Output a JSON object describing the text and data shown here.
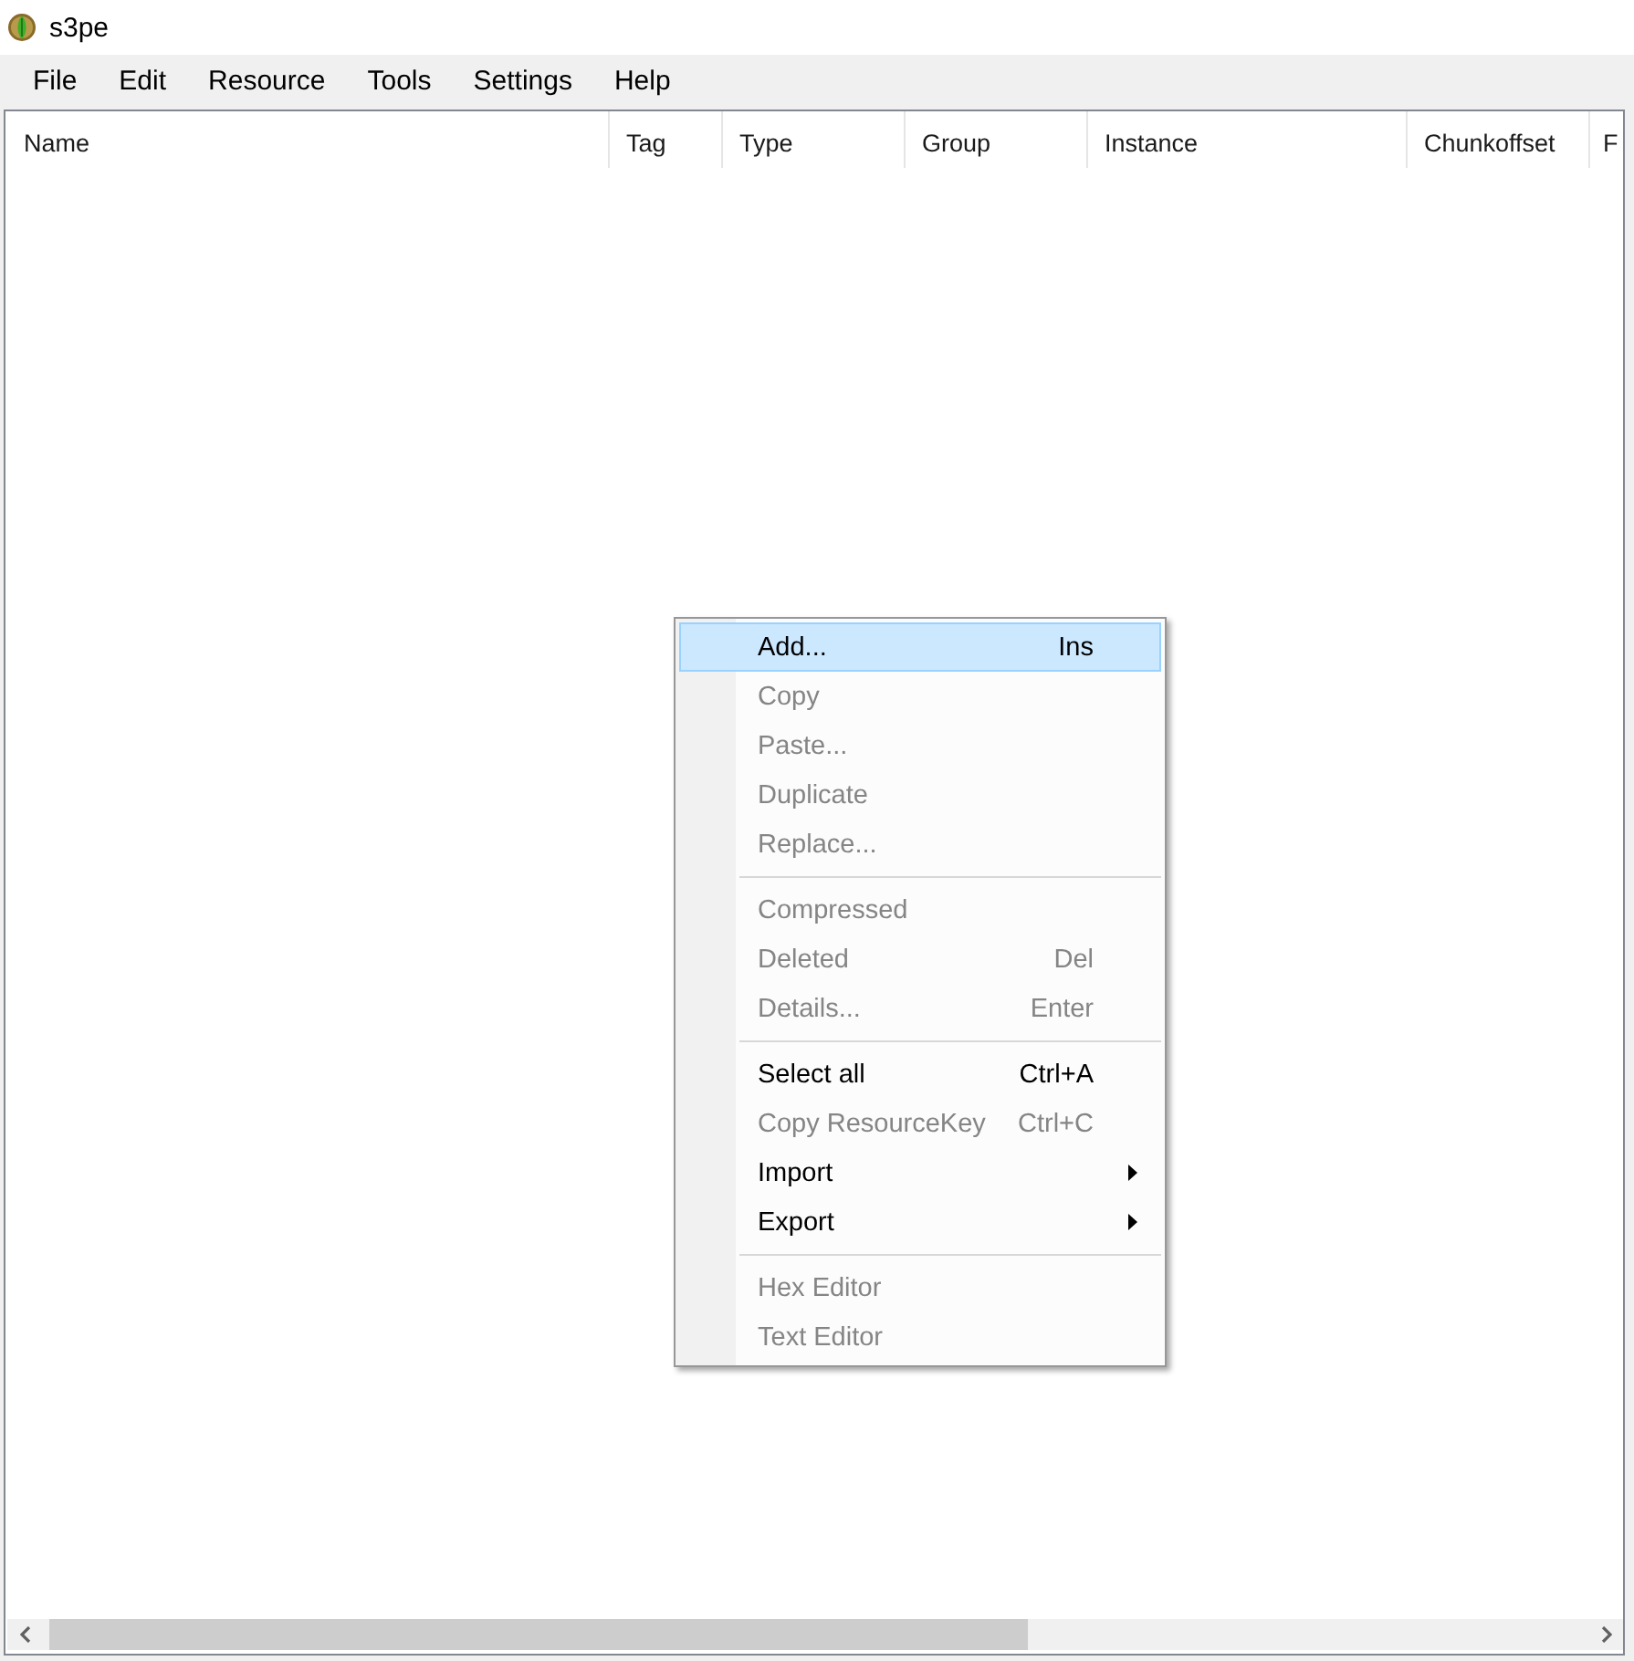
{
  "window": {
    "title": "s3pe"
  },
  "menu_bar": [
    "File",
    "Edit",
    "Resource",
    "Tools",
    "Settings",
    "Help"
  ],
  "resource_list": {
    "columns": [
      "Name",
      "Tag",
      "Type",
      "Group",
      "Instance",
      "Chunkoffset"
    ],
    "column_7": "F"
  },
  "context_menu": {
    "sections": [
      {
        "items": [
          {
            "label": "Add...",
            "shortcut": "Ins",
            "disabled": false,
            "highlighted": true,
            "submenu": false
          },
          {
            "label": "Copy",
            "disabled": true,
            "highlighted": false,
            "submenu": false
          },
          {
            "label": "Paste...",
            "disabled": true,
            "highlighted": false,
            "submenu": false
          },
          {
            "label": "Duplicate",
            "disabled": true,
            "highlighted": false,
            "submenu": false
          },
          {
            "label": "Replace...",
            "disabled": true,
            "highlighted": false,
            "submenu": false
          }
        ]
      },
      {
        "items": [
          {
            "label": "Compressed",
            "disabled": true,
            "highlighted": false,
            "submenu": false
          },
          {
            "label": "Deleted",
            "shortcut": "Del",
            "disabled": true,
            "highlighted": false,
            "submenu": false
          },
          {
            "label": "Details...",
            "shortcut": "Enter",
            "disabled": true,
            "highlighted": false,
            "submenu": false
          }
        ]
      },
      {
        "items": [
          {
            "label": "Select all",
            "shortcut": "Ctrl+A",
            "disabled": false,
            "highlighted": false,
            "submenu": false
          },
          {
            "label": "Copy ResourceKey",
            "shortcut": "Ctrl+C",
            "disabled": true,
            "highlighted": false,
            "submenu": false
          },
          {
            "label": "Import",
            "disabled": false,
            "highlighted": false,
            "submenu": true
          },
          {
            "label": "Export",
            "disabled": false,
            "highlighted": false,
            "submenu": true
          }
        ]
      },
      {
        "items": [
          {
            "label": "Hex Editor",
            "disabled": true,
            "highlighted": false,
            "submenu": false
          },
          {
            "label": "Text Editor",
            "disabled": true,
            "highlighted": false,
            "submenu": false
          }
        ]
      }
    ]
  }
}
